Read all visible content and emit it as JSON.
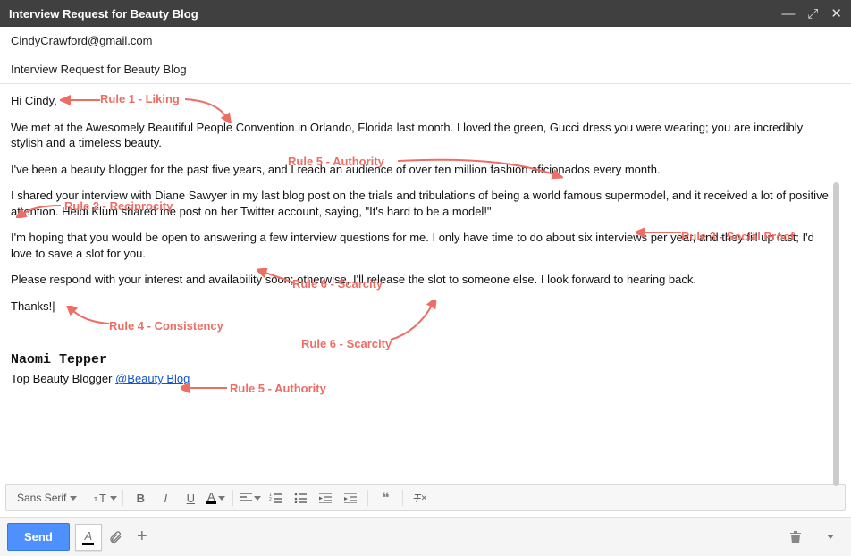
{
  "titlebar": {
    "title": "Interview Request for Beauty Blog"
  },
  "fields": {
    "to": "CindyCrawford@gmail.com",
    "subject": "Interview Request for Beauty Blog"
  },
  "body": {
    "greeting": "Hi Cindy,",
    "p1": "We met at the Awesomely Beautiful People Convention in Orlando, Florida last month. I loved the green, Gucci dress you were wearing; you are incredibly stylish and a timeless beauty.",
    "p2": "I've been a beauty blogger for the past five years, and I reach an audience of over ten million fashion aficionados every month.",
    "p3": "I shared your interview with Diane Sawyer in my last blog post on the trials and tribulations of being a world famous supermodel, and it received a lot of positive attention. Heidi Klum shared the post on her Twitter account, saying, \"It's hard to be a model!\"",
    "p4": "I'm hoping that you would be open to answering a few interview questions for me. I only have time to do about six interviews per year, and they fill up fast; I'd love to save a slot for you.",
    "p5": "Please respond with your interest and availability soon; otherwise, I'll release the slot to someone else. I look forward to hearing back.",
    "thanks": "Thanks!",
    "sig_divider": "--",
    "sig_name": "Naomi Tepper",
    "sig_title": "Top Beauty Blogger ",
    "sig_link": "@Beauty Blog"
  },
  "annotations": {
    "r1": "Rule 1 - Liking",
    "r2": "Rule 2 - Reciprocity",
    "r3": "Rule 3 - Social Proof",
    "r4": "Rule 4 - Consistency",
    "r5a": "Rule 5 - Authority",
    "r5b": "Rule 5 - Authority",
    "r6a": "Rule 6 - Scarcity",
    "r6b": "Rule 6 - Scarcity"
  },
  "toolbar": {
    "font": "Sans Serif"
  },
  "footer": {
    "send": "Send"
  }
}
